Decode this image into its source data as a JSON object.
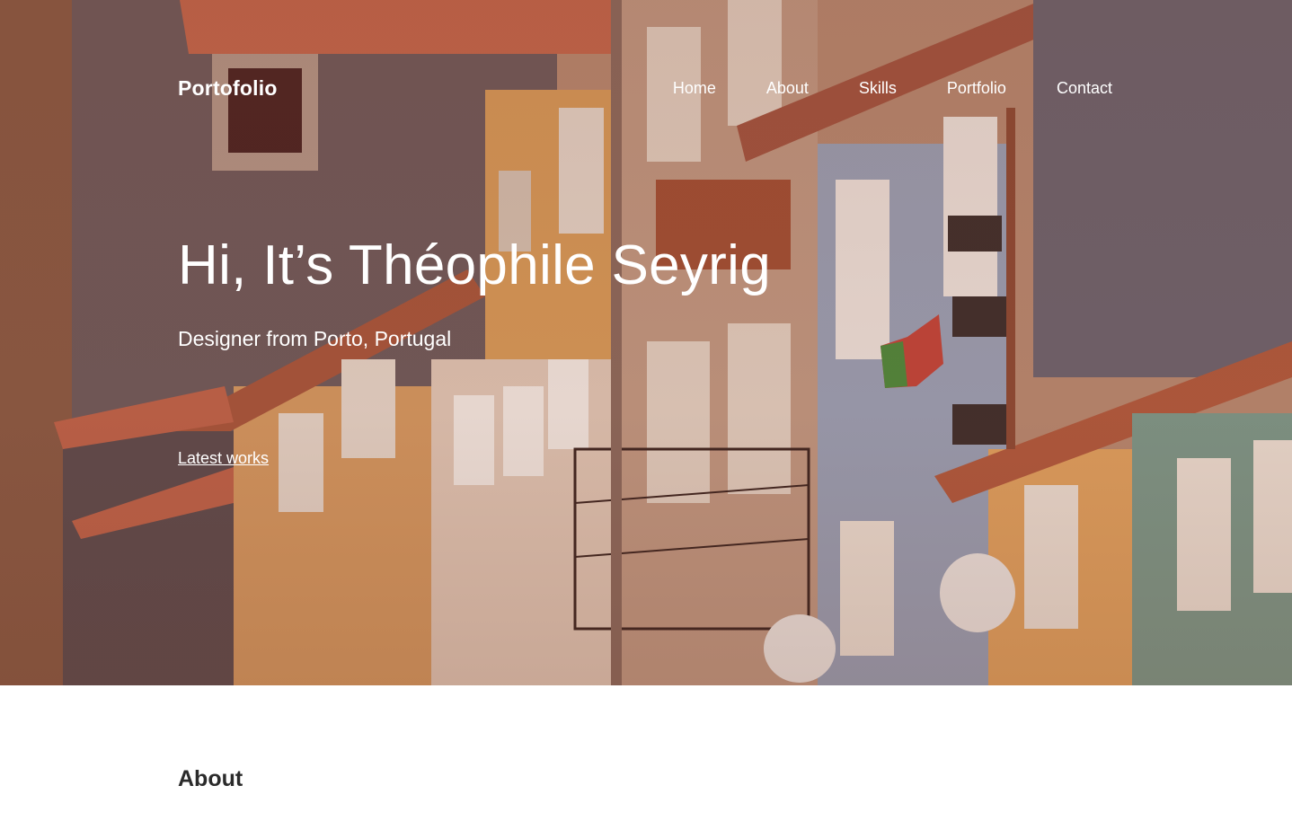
{
  "header": {
    "brand": "Portofolio",
    "nav": [
      {
        "label": "Home"
      },
      {
        "label": "About"
      },
      {
        "label": "Skills"
      },
      {
        "label": "Portfolio"
      },
      {
        "label": "Contact"
      }
    ]
  },
  "hero": {
    "title": "Hi, It’s Théophile Seyrig",
    "subtitle": "Designer from Porto, Portugal",
    "cta_label": "Latest works",
    "background_image": "porto-houses-photo"
  },
  "sections": {
    "about_heading": "About"
  },
  "colors": {
    "text_on_hero": "#ffffff",
    "heading_dark": "#2b2b2b",
    "page_background": "#ffffff",
    "hero_tint": "#7a4a36"
  }
}
